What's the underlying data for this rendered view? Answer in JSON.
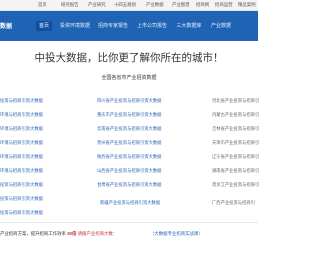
{
  "topbar": {
    "items": [
      "首页",
      "研究报告",
      "产业研究",
      "十四五规划",
      "产业数据",
      "产业图谱",
      "招商网",
      "招商运营",
      "精品案例"
    ]
  },
  "navbar": {
    "logo": "数据",
    "tabs": [
      "首页",
      "投资环境数据",
      "招商专家报告",
      "上市公司报告",
      "三大数据库",
      "产业数据"
    ],
    "active_tab": "首页"
  },
  "headline": "中投大数据，比你更了解你所在的城市！",
  "subhead": "全国各省市产业招资数据",
  "columns": [
    {
      "items": [
        "投资与招商引资大数据",
        "环境与招商引资大数据",
        "环境与招商引资大数据",
        "环境与招商引资大数据",
        "环境与招商引资大数据",
        "环境与招商引资大数据",
        "投资与招商引资大数据",
        "投资与招商引资大数据",
        "投资与招商引资大数据",
        "环境与招商引资大数据"
      ]
    },
    {
      "items": [
        "四川省产业投资与招商引资大数据",
        "重庆市产业投资与招商引资大数据",
        "云南省产业投资与招商引资大数据",
        "贵州省产业投资与招商引资大数据",
        "陕西省产业投资与招商引资大数据",
        "山西省产业投资与招商引资大数据",
        "甘肃省产业投资与招商引资大数据",
        "新疆产业投资与招商引资大数据"
      ]
    },
    {
      "items": [
        "河北省产业投资与招商引",
        "内蒙古产业投资与招商引",
        "吉林省产业投资与招商引",
        "天津市产业投资与招商引",
        "辽宁省产业投资与招商引",
        "湖南省产业投资与招商引",
        "黑龙江产业投资与招商引",
        "广西产业投资与招商引"
      ]
    }
  ],
  "bottom": {
    "prefix": "产业招商方案，提升招商工作效率",
    "phone": "30倍",
    "cta": "请拨产业招商大数：",
    "right_link": "（大数据专业招商实战课）"
  },
  "colors": {
    "nav_bg": "#1f63b5",
    "active_tab_bg": "#0e4f9e",
    "link_blue": "#2a64b8",
    "accent_red": "#c0392b"
  }
}
